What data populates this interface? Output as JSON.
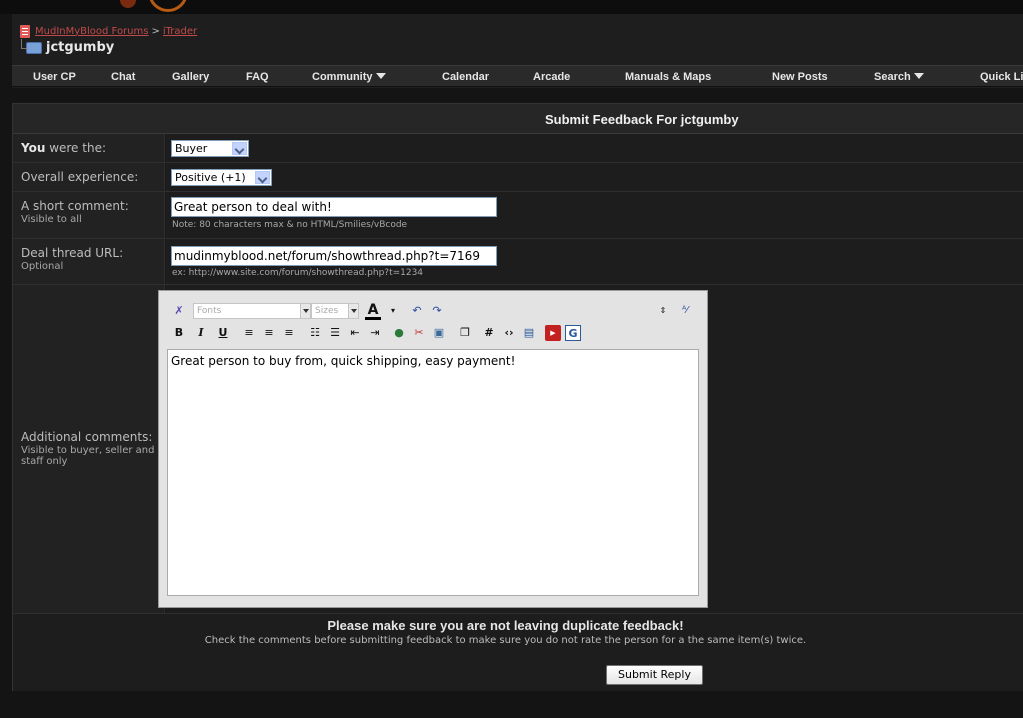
{
  "breadcrumb": {
    "forum_link": "MudInMyBlood Forums",
    "separator": ">",
    "section_link": "iTrader"
  },
  "page_title": "jctgumby",
  "nav": {
    "items": [
      {
        "label": "User CP"
      },
      {
        "label": "Chat"
      },
      {
        "label": "Gallery"
      },
      {
        "label": "FAQ"
      },
      {
        "label": "Community"
      },
      {
        "label": "Calendar"
      },
      {
        "label": "Arcade"
      },
      {
        "label": "Manuals & Maps"
      },
      {
        "label": "New Posts"
      },
      {
        "label": "Search"
      },
      {
        "label": "Quick Li"
      }
    ]
  },
  "form": {
    "header": "Submit Feedback For jctgumby",
    "you_were_the": {
      "label_bold": "You",
      "label_rest": " were the:",
      "value": "Buyer"
    },
    "overall": {
      "label": "Overall experience:",
      "value": "Positive (+1)"
    },
    "short_comment": {
      "label": "A short comment:",
      "sub": "Visible to all",
      "value": "Great person to deal with!",
      "note": "Note: 80 characters max & no HTML/Smilies/vBcode"
    },
    "deal_url": {
      "label": "Deal thread URL:",
      "sub": "Optional",
      "value": "mudinmyblood.net/forum/showthread.php?t=7169",
      "note": "ex: http://www.site.com/forum/showthread.php?t=1234"
    },
    "additional": {
      "label": "Additional comments:",
      "sub": "Visible to buyer, seller and staff only",
      "value": "Great person to buy from, quick shipping, easy payment!"
    },
    "editor": {
      "font_select": "Fonts",
      "size_select": "Sizes"
    },
    "warning_title": "Please make sure you are not leaving duplicate feedback!",
    "warning_sub": "Check the comments before submitting feedback to make sure you do not rate the person for a the same item(s) twice.",
    "submit_label": "Submit Reply"
  },
  "colors": {
    "link": "#c04a4a",
    "background": "#141414",
    "panel": "#1e1e1e"
  }
}
